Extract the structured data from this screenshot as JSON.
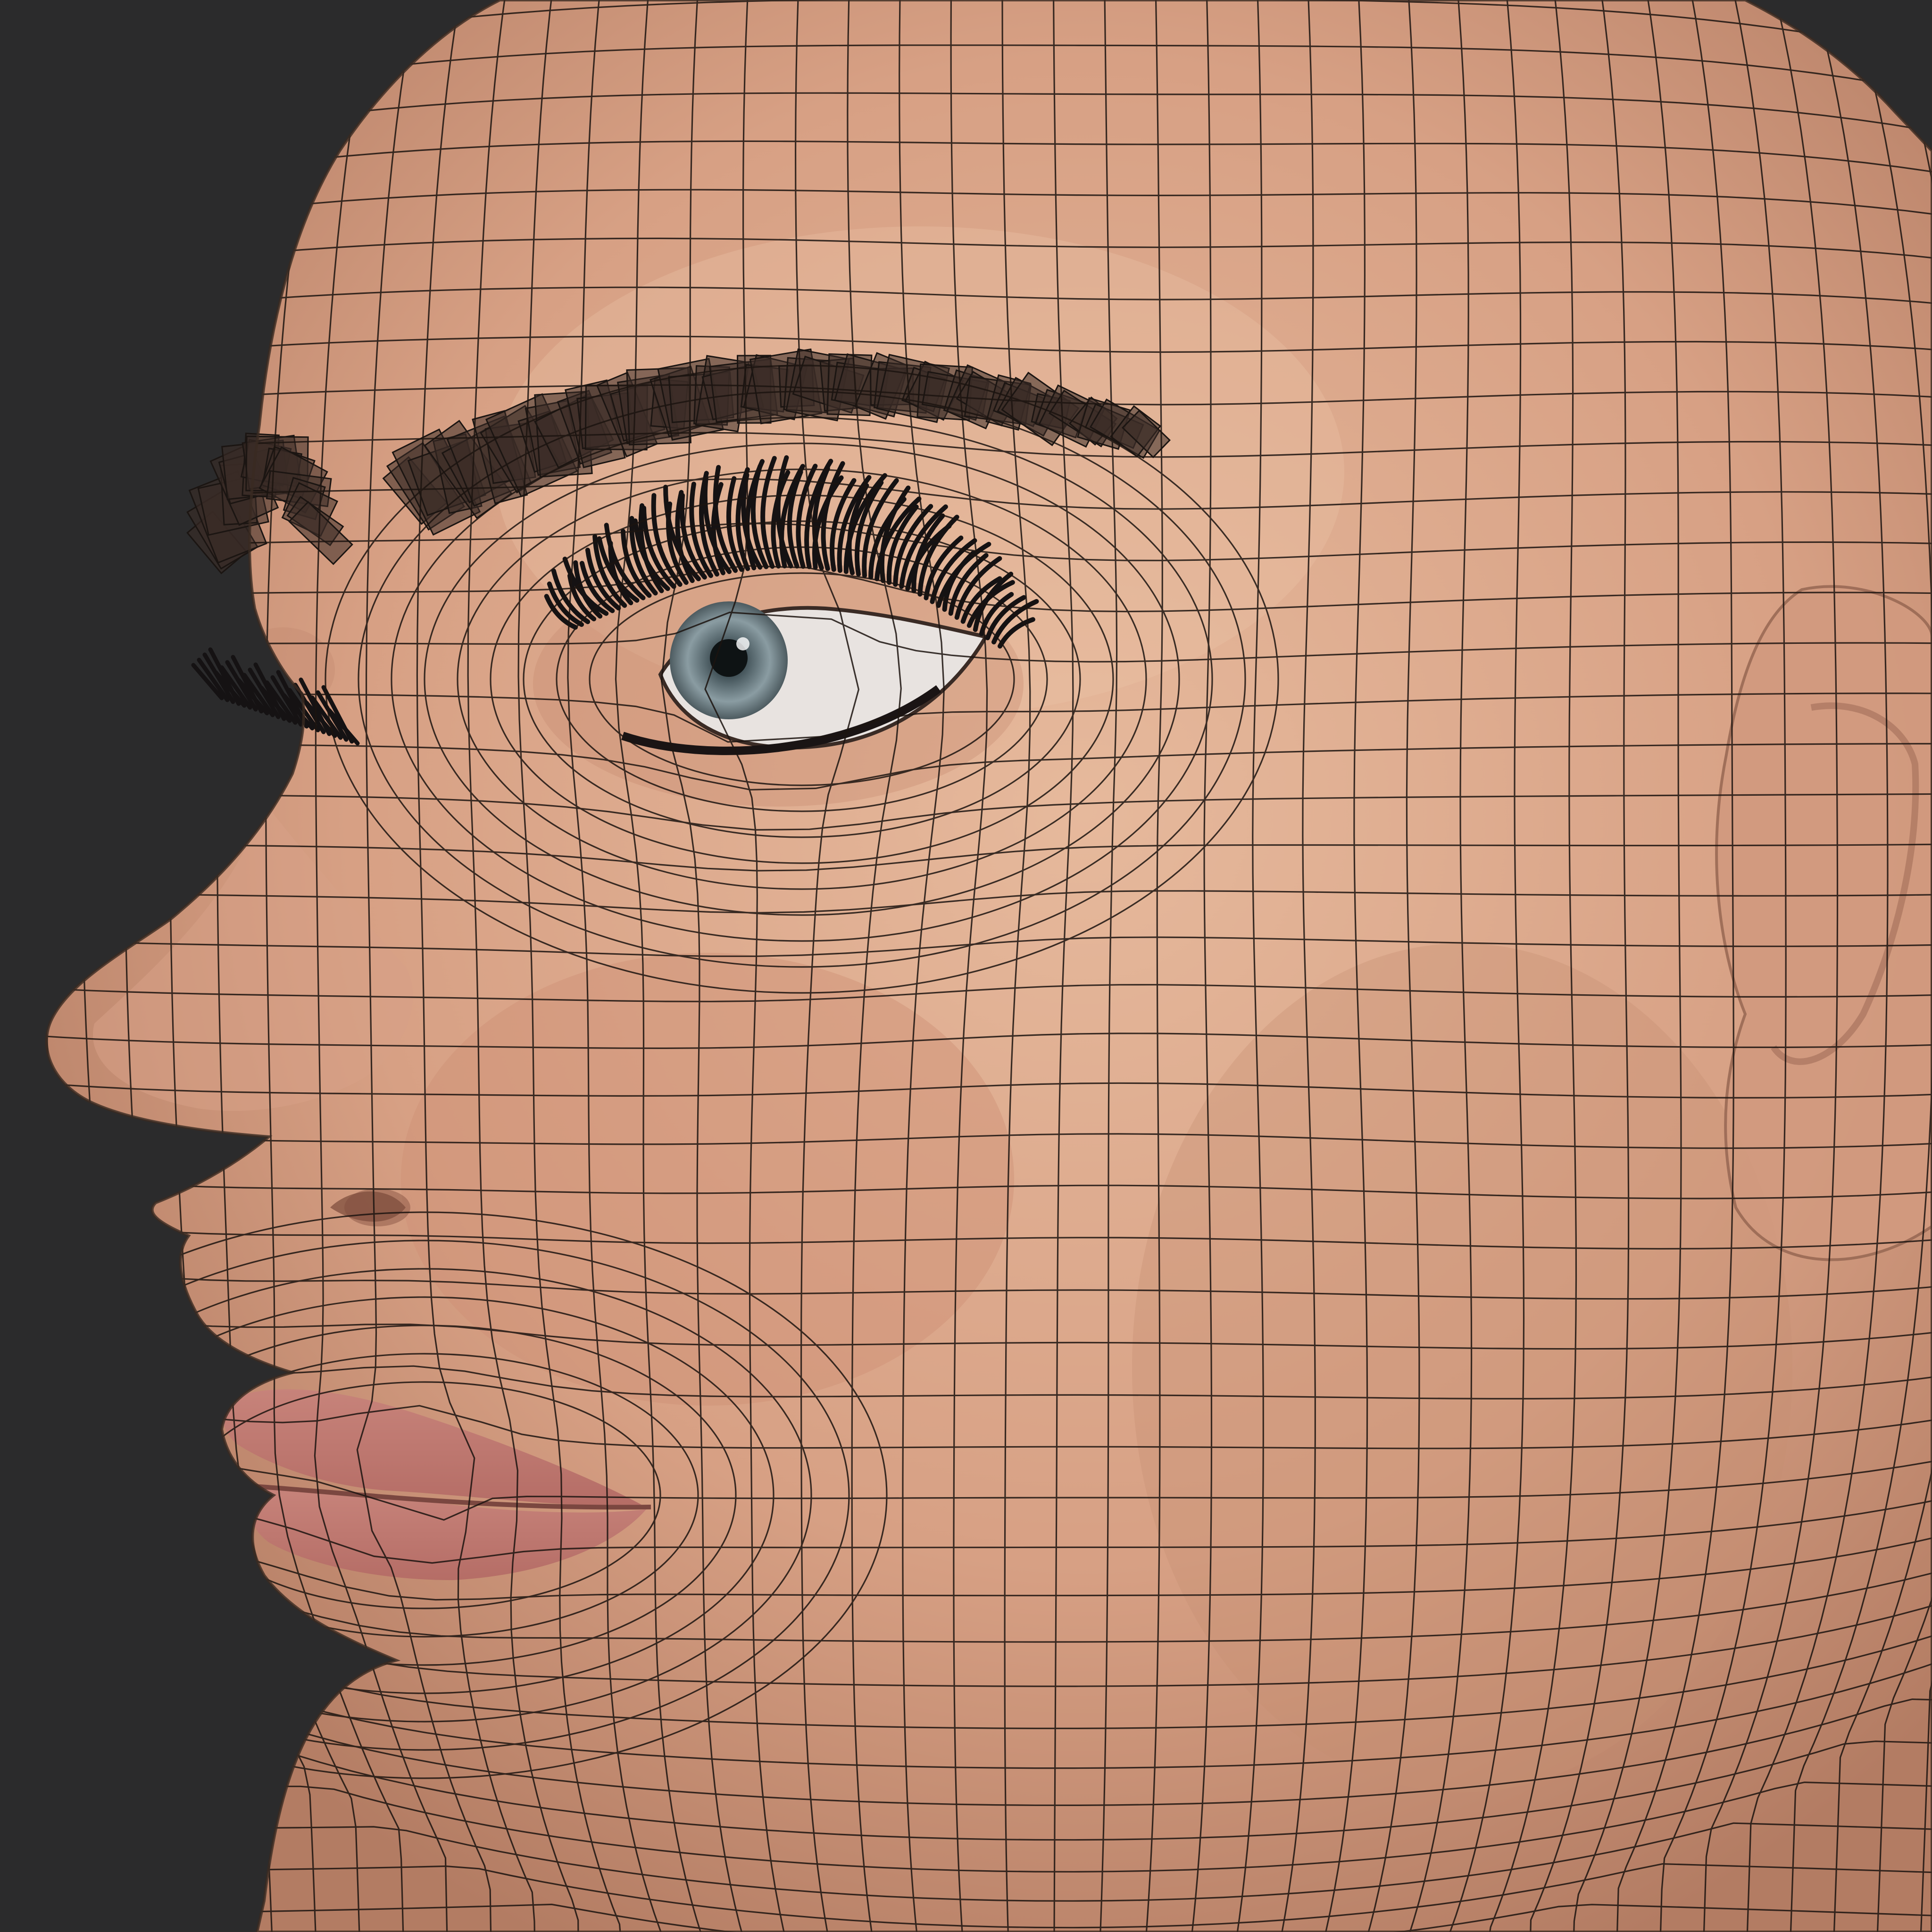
{
  "scene": {
    "subject": "head-mesh",
    "display_mode": "textured-wireframe-overlay",
    "colors": {
      "background": "#2b2b2c",
      "skin_light": "#e2b497",
      "skin_mid": "#d39c80",
      "skin_shadow": "#a5735c",
      "lip": "#c98478",
      "wire": "#1c1410",
      "lash": "#151213",
      "brow": "#3a2c26",
      "iris": "#7d8f95",
      "sclera": "#e8e3e0"
    }
  }
}
